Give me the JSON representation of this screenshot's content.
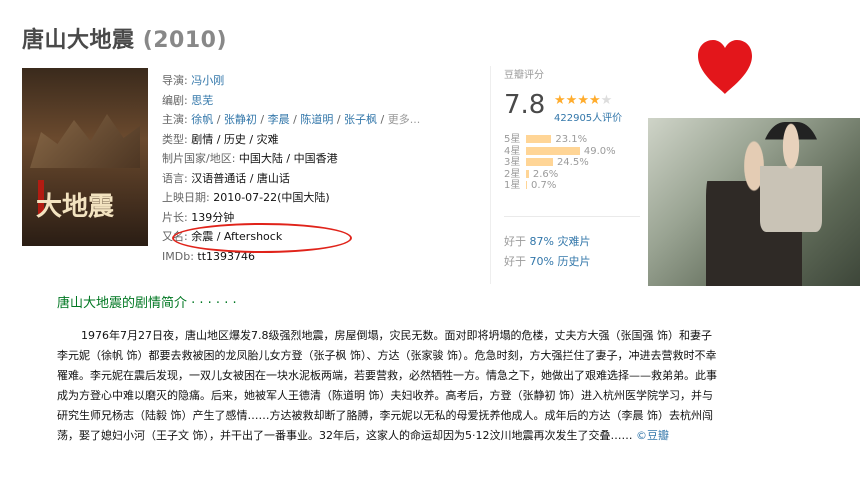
{
  "title": {
    "name": "唐山大地震",
    "year": "(2010)"
  },
  "poster": {
    "text": "大地震"
  },
  "info": {
    "director_label": "导演:",
    "director": "冯小刚",
    "writer_label": "编剧:",
    "writer": "思芜",
    "cast_label": "主演:",
    "cast": [
      "徐帆",
      "张静初",
      "李晨",
      "陈道明",
      "张子枫"
    ],
    "cast_more": "更多...",
    "genre_label": "类型:",
    "genre": "剧情 / 历史 / 灾难",
    "region_label": "制片国家/地区:",
    "region": "中国大陆 / 中国香港",
    "language_label": "语言:",
    "language": "汉语普通话 / 唐山话",
    "release_label": "上映日期:",
    "release": "2010-07-22(中国大陆)",
    "runtime_label": "片长:",
    "runtime": "139分钟",
    "aka_label": "又名:",
    "aka": "余震 / Aftershock",
    "imdb_label": "IMDb:",
    "imdb": "tt1393746"
  },
  "rating": {
    "label": "豆瓣评分",
    "score": "7.8",
    "stars_filled": 4,
    "stars_half": false,
    "votes": "422905人评价",
    "breakdown": [
      {
        "label": "5星",
        "pct": "23.1%",
        "value": 23.1
      },
      {
        "label": "4星",
        "pct": "49.0%",
        "value": 49.0
      },
      {
        "label": "3星",
        "pct": "24.5%",
        "value": 24.5
      },
      {
        "label": "2星",
        "pct": "2.6%",
        "value": 2.6
      },
      {
        "label": "1星",
        "pct": "0.7%",
        "value": 0.7
      }
    ],
    "better1_prefix": "好于",
    "better1_pct": "87%",
    "better1_genre": "灾难片",
    "better2_prefix": "好于",
    "better2_pct": "70%",
    "better2_genre": "历史片"
  },
  "synopsis": {
    "heading": "唐山大地震的剧情简介 · · · · · ·",
    "body": "1976年7月27日夜，唐山地区爆发7.8级强烈地震，房屋倒塌，灾民无数。面对即将坍塌的危楼，丈夫方大强（张国强 饰）和妻子李元妮（徐帆 饰）都要去救被困的龙凤胎儿女方登（张子枫 饰）、方达（张家骏 饰）。危急时刻，方大强拦住了妻子，冲进去营救时不幸罹难。李元妮在震后发现，一双儿女被困在一块水泥板两端，若要营救，必然牺牲一方。情急之下，她做出了艰难选择——救弟弟。此事成为方登心中难以磨灭的隐痛。后来，她被军人王德清（陈道明 饰）夫妇收养。高考后，方登（张静初 饰）进入杭州医学院学习，并与研究生师兄杨志（陆毅 饰）产生了感情……方达被救却断了胳膊，李元妮以无私的母爱抚养他成人。成年后的方达（李晨 饰）去杭州闯荡，娶了媳妇小河（王子文 饰），并干出了一番事业。32年后，这家人的命运却因为5·12汶川地震再次发生了交叠……",
    "source": "©豆瓣"
  },
  "colors": {
    "link": "#3377aa",
    "green": "#007722",
    "star": "#ffac2d",
    "heart": "#e3161b",
    "annotation": "#e0231a"
  },
  "icons": {
    "heart": "heart-icon",
    "star": "star-icon"
  }
}
